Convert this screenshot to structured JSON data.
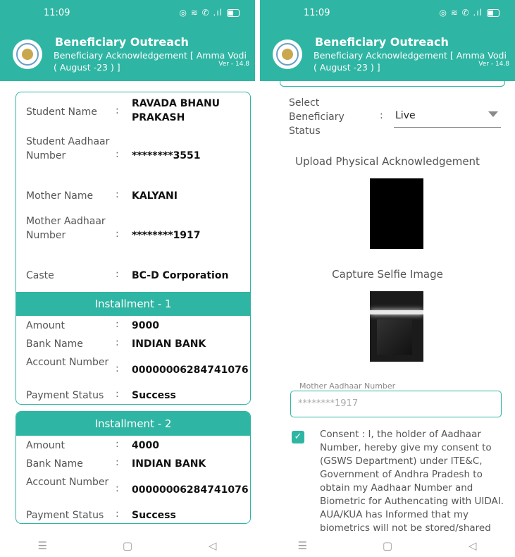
{
  "status_time": "11:09",
  "status_icons": "◎ ≋ ✆ .ıl",
  "app": {
    "title": "Beneficiary Outreach",
    "subtitle": "Beneficiary Acknowledgement [ Amma Vodi ( August -23 ) ]",
    "version": "Ver - 14.8"
  },
  "left": {
    "student_name_label": "Student Name",
    "student_name": "RAVADA BHANU PRAKASH",
    "student_aadhaar_label": "Student Aadhaar Number",
    "student_aadhaar": "********3551",
    "mother_name_label": "Mother Name",
    "mother_name": "KALYANI",
    "mother_aadhaar_label": "Mother Aadhaar Number",
    "mother_aadhaar": "********1917",
    "caste_label": "Caste",
    "caste": "BC-D Corporation",
    "installments": [
      {
        "title": "Installment - 1",
        "amount_label": "Amount",
        "amount": "9000",
        "bank_label": "Bank Name",
        "bank": "INDIAN BANK",
        "account_label": "Account Number",
        "account": "00000006284741076",
        "payment_label": "Payment Status",
        "payment": "Success"
      },
      {
        "title": "Installment - 2",
        "amount_label": "Amount",
        "amount": "4000",
        "bank_label": "Bank Name",
        "bank": "INDIAN BANK",
        "account_label": "Account Number",
        "account": "00000006284741076",
        "payment_label": "Payment Status",
        "payment": "Success"
      }
    ]
  },
  "right": {
    "select_label": "Select Beneficiary Status",
    "select_value": "Live",
    "upload_title": "Upload Physical Acknowledgement",
    "selfie_title": "Capture Selfie Image",
    "mother_aadhaar_label": "Mother Aadhaar Number",
    "mother_aadhaar_value": "********1917",
    "consent": "Consent : I, the holder of Aadhaar Number, hereby give my consent to (GSWS Department) under ITE&C, Government of Andhra Pradesh to obtain my Aadhaar Number and Biometric for Authencating with UIDAI. AUA/KUA has Informed that my biometrics will not be stored/shared"
  },
  "nav": {
    "menu": "☰",
    "home": "▢",
    "back": "◁"
  },
  "colors": {
    "primary": "#2fb5a3"
  }
}
